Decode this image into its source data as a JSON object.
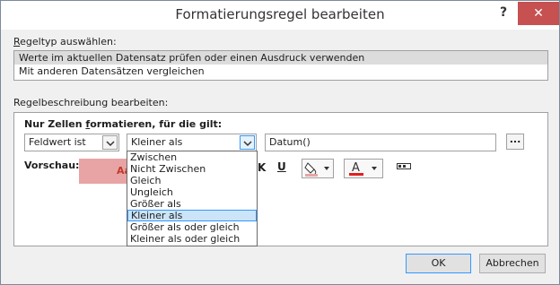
{
  "dialog": {
    "title": "Formatierungsregel bearbeiten",
    "help_label": "?",
    "close_label": "✕"
  },
  "rule_type": {
    "label_access": "R",
    "label_rest": "egeltyp auswählen:",
    "items": [
      {
        "label": "Werte im aktuellen Datensatz prüfen oder einen Ausdruck verwenden",
        "selected": true
      },
      {
        "label": "Mit anderen Datensätzen vergleichen",
        "selected": false
      }
    ]
  },
  "description": {
    "label": "Regelbeschreibung bearbeiten:",
    "condition_label_pre": "Nur Zellen ",
    "condition_label_access": "f",
    "condition_label_post": "ormatieren, für die gilt:",
    "field_combo": "Feldwert ist",
    "operator_combo": "Kleiner als",
    "value": "Datum()",
    "ellipsis_label": "...",
    "preview_label": "Vorschau:",
    "preview_text": "Aa"
  },
  "format_toolbar": {
    "strike_label": "K",
    "underline_label": "U"
  },
  "operator_options": [
    "Zwischen",
    "Nicht Zwischen",
    "Gleich",
    "Ungleich",
    "Größer als",
    "Kleiner als",
    "Größer als oder gleich",
    "Kleiner als oder gleich"
  ],
  "operator_selected": "Kleiner als",
  "buttons": {
    "ok": "OK",
    "cancel": "Abbrechen"
  },
  "colors": {
    "preview_fill": "#e8a4a4",
    "font_color_bar": "#e02020",
    "selection": "#cce4f7",
    "close_button": "#c75050"
  }
}
